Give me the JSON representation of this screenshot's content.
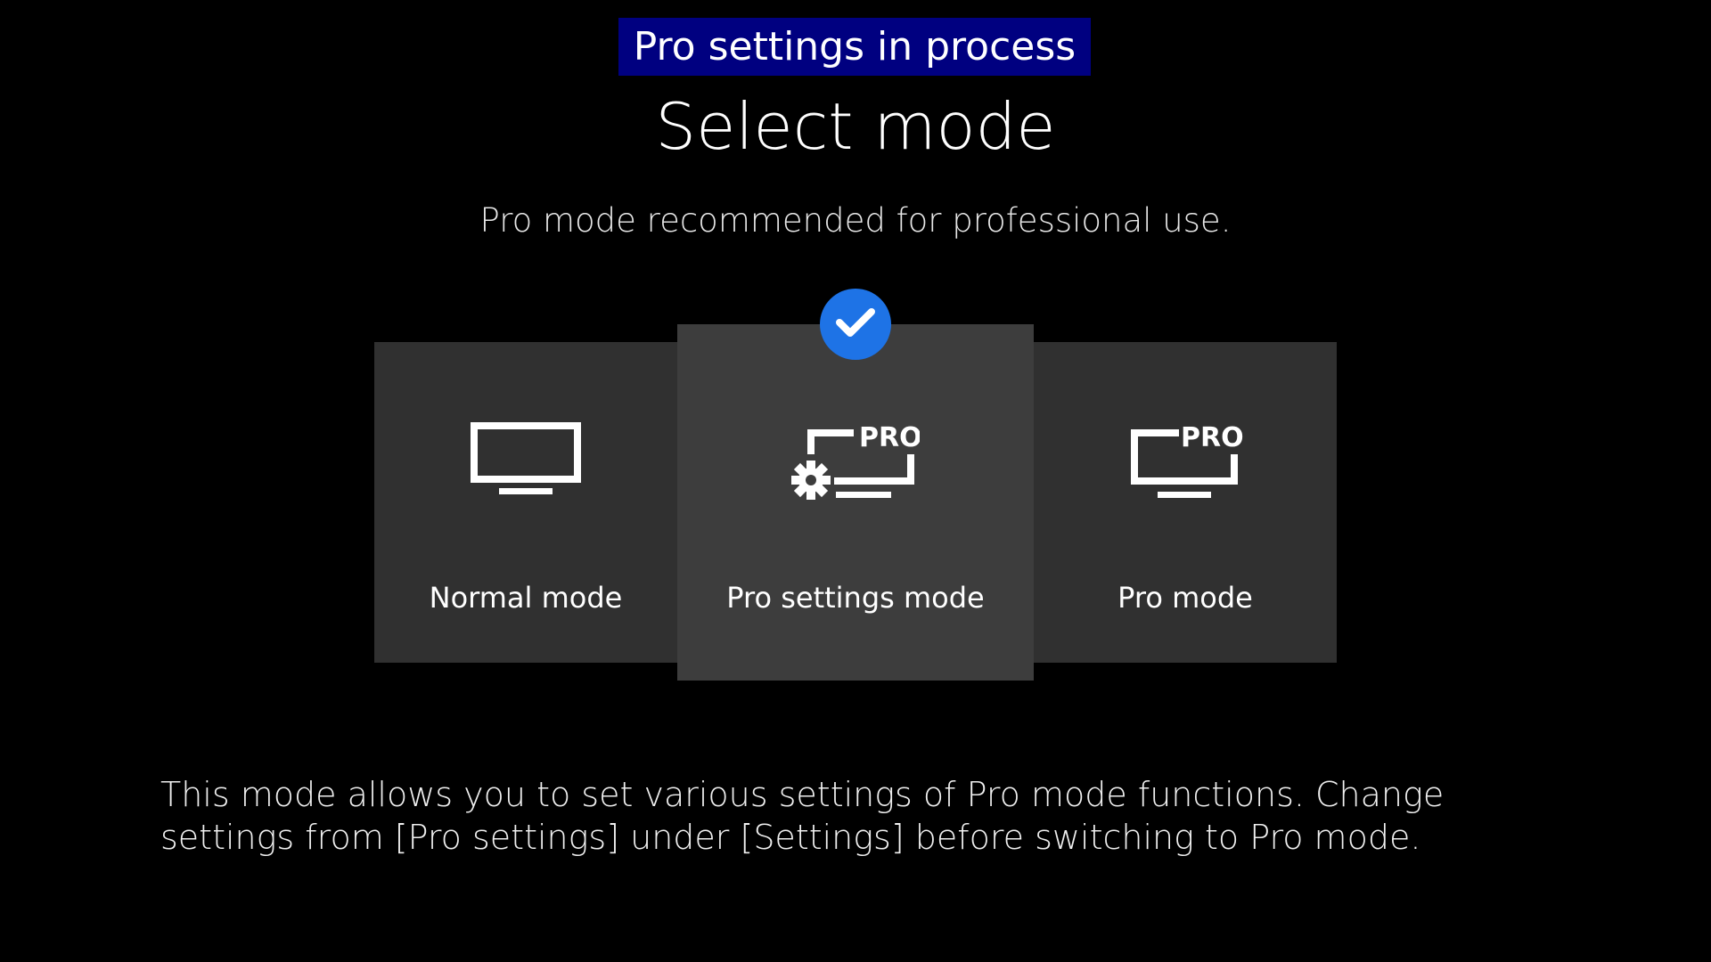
{
  "banner": {
    "text": "Pro settings in process",
    "color": "#000080"
  },
  "header": {
    "title": "Select mode",
    "subtitle": "Pro mode recommended for professional use."
  },
  "modes": [
    {
      "label": "Normal mode",
      "icon": "monitor-icon",
      "selected": false
    },
    {
      "label": "Pro settings mode",
      "icon": "monitor-pro-settings-icon",
      "badge": "PRO",
      "selected": true
    },
    {
      "label": "Pro mode",
      "icon": "monitor-pro-icon",
      "badge": "PRO",
      "selected": false
    }
  ],
  "selection_indicator": {
    "icon": "checkmark-icon",
    "color": "#1e73e6"
  },
  "description": "This mode allows you to set various settings of Pro mode functions. Change settings from [Pro settings] under [Settings] before switching to Pro mode."
}
